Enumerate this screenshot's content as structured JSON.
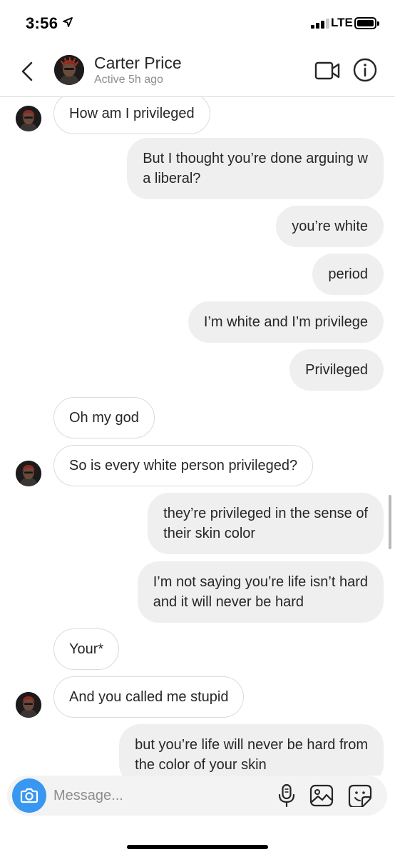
{
  "status_bar": {
    "time": "3:56",
    "network": "LTE"
  },
  "header": {
    "name": "Carter Price",
    "status": "Active 5h ago",
    "icons": [
      "back-chevron-icon",
      "video-call-icon",
      "info-icon"
    ]
  },
  "messages": [
    {
      "side": "in",
      "text": "How am I privileged",
      "avatar": true
    },
    {
      "side": "out",
      "text": "But I thought you’re done arguing w\na liberal?"
    },
    {
      "side": "out",
      "text": "you’re white"
    },
    {
      "side": "out",
      "text": "period"
    },
    {
      "side": "out",
      "text": "I’m white and I’m privilege"
    },
    {
      "side": "out",
      "text": "Privileged"
    },
    {
      "side": "in",
      "text": "Oh my god",
      "avatar": false
    },
    {
      "side": "in",
      "text": "So is every white person privileged?",
      "avatar": true
    },
    {
      "side": "out",
      "text": "they’re privileged in the sense of\ntheir skin color"
    },
    {
      "side": "out",
      "text": "I’m not saying you’re life isn’t hard\nand it will never be hard"
    },
    {
      "side": "in",
      "text": "Your*",
      "avatar": false
    },
    {
      "side": "in",
      "text": "And you called me stupid",
      "avatar": true
    },
    {
      "side": "out",
      "text": "but you’re life will never be hard from\nthe color of your skin"
    }
  ],
  "composer": {
    "placeholder": "Message...",
    "icons": [
      "camera-icon",
      "microphone-icon",
      "gallery-icon",
      "sticker-icon"
    ]
  },
  "colors": {
    "accent": "#3897f0",
    "bubble_out": "#efefef",
    "bubble_in_border": "#dbdbdb",
    "text": "#262626",
    "secondary_text": "#8e8e8e"
  }
}
